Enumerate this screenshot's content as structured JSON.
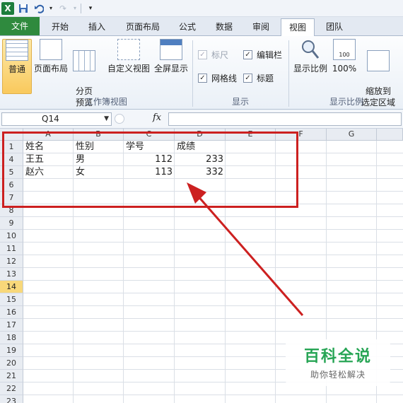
{
  "tabs": [
    "文件",
    "开始",
    "插入",
    "页面布局",
    "公式",
    "数据",
    "审阅",
    "视图",
    "团队"
  ],
  "ribbon": {
    "workbook_views": {
      "buttons": [
        "普通",
        "页面布局",
        "分页\n预览",
        "自定义视图",
        "全屏显示"
      ],
      "label": "工作簿视图"
    },
    "show": {
      "items": [
        {
          "label": "标尺",
          "checked": true,
          "disabled": true
        },
        {
          "label": "编辑栏",
          "checked": true,
          "disabled": false
        },
        {
          "label": "网格线",
          "checked": true,
          "disabled": false
        },
        {
          "label": "标题",
          "checked": true,
          "disabled": false
        }
      ],
      "label": "显示"
    },
    "zoom": {
      "buttons": [
        "显示比例",
        "100%",
        "缩放到\n选定区域"
      ],
      "label": "显示比例"
    }
  },
  "formula_bar": {
    "name_box": "Q14",
    "fx": "fx",
    "value": ""
  },
  "columns": [
    "A",
    "B",
    "C",
    "D",
    "E",
    "F",
    "G"
  ],
  "rows": [
    "1",
    "4",
    "5",
    "6",
    "7",
    "8",
    "9",
    "10",
    "11",
    "12",
    "13",
    "14",
    "15",
    "16",
    "17",
    "18",
    "19",
    "20",
    "21",
    "22",
    "23"
  ],
  "selected_row": "14",
  "cells": [
    [
      "姓名",
      "性别",
      "学号",
      "成绩"
    ],
    [
      "王五",
      "男",
      "112",
      "233"
    ],
    [
      "赵六",
      "女",
      "113",
      "332"
    ]
  ],
  "watermark": {
    "title": "百科全说",
    "subtitle": "助你轻松解决"
  },
  "colors": {
    "file_tab": "#2f8a3e",
    "annotation": "#cc2020",
    "selected_row": "#f8d87a",
    "watermark": "#27a555"
  }
}
